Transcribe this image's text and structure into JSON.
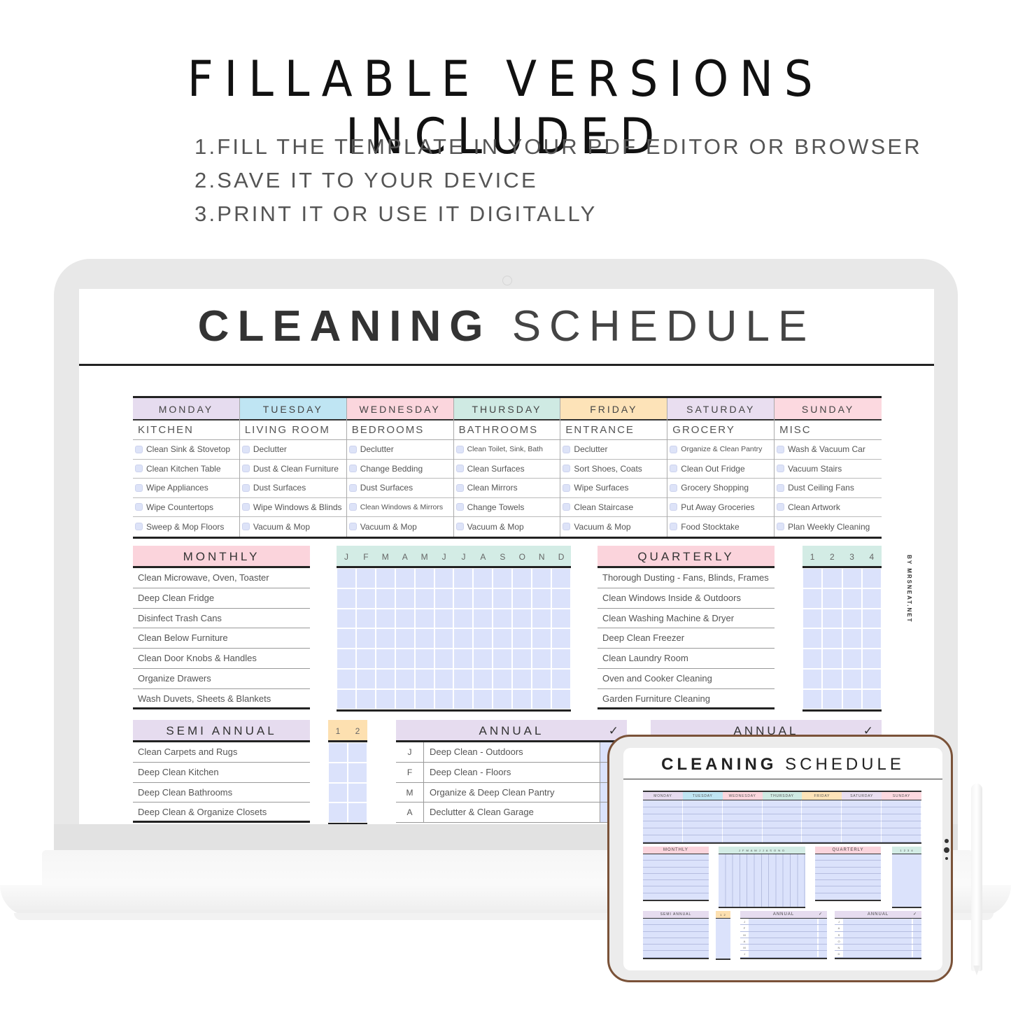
{
  "headline": "FILLABLE VERSIONS INCLUDED",
  "steps": [
    "1.FILL THE TEMPLATE IN YOUR PDF EDITOR OR BROWSER",
    "2.SAVE IT TO YOUR DEVICE",
    "3.PRINT IT OR USE IT DIGITALLY"
  ],
  "planner": {
    "title_bold": "CLEANING",
    "title_light": "SCHEDULE",
    "credit": "BY MRSNEAT.NET",
    "days": [
      {
        "day": "MONDAY",
        "color": "#e6dcef",
        "room": "KITCHEN",
        "tasks": [
          "Clean Sink & Stovetop",
          "Clean Kitchen Table",
          "Wipe Appliances",
          "Wipe Countertops",
          "Sweep & Mop Floors"
        ]
      },
      {
        "day": "TUESDAY",
        "color": "#bfe5f3",
        "room": "LIVING ROOM",
        "tasks": [
          "Declutter",
          "Dust & Clean Furniture",
          "Dust Surfaces",
          "Wipe Windows & Blinds",
          "Vacuum & Mop"
        ]
      },
      {
        "day": "WEDNESDAY",
        "color": "#fbd6dd",
        "room": "BEDROOMS",
        "tasks": [
          "Declutter",
          "Change Bedding",
          "Dust Surfaces",
          "Clean Windows & Mirrors",
          "Vacuum & Mop"
        ]
      },
      {
        "day": "THURSDAY",
        "color": "#cfeae3",
        "room": "BATHROOMS",
        "tasks": [
          "Clean Toilet, Sink, Bath",
          "Clean Surfaces",
          "Clean Mirrors",
          "Change Towels",
          "Vacuum & Mop"
        ]
      },
      {
        "day": "FRIDAY",
        "color": "#fde3b8",
        "room": "ENTRANCE",
        "tasks": [
          "Declutter",
          "Sort Shoes, Coats",
          "Wipe Surfaces",
          "Clean Staircase",
          "Vacuum & Mop"
        ]
      },
      {
        "day": "SATURDAY",
        "color": "#e9def0",
        "room": "GROCERY",
        "tasks": [
          "Organize & Clean Pantry",
          "Clean Out Fridge",
          "Grocery Shopping",
          "Put Away Groceries",
          "Food Stocktake"
        ]
      },
      {
        "day": "SUNDAY",
        "color": "#fcd9e0",
        "room": "MISC",
        "tasks": [
          "Wash & Vacuum Car",
          "Vacuum Stairs",
          "Dust Ceiling Fans",
          "Clean Artwork",
          "Plan Weekly Cleaning"
        ]
      }
    ],
    "monthly": {
      "title": "MONTHLY",
      "color": "#fbd4dc",
      "tasks": [
        "Clean Microwave, Oven, Toaster",
        "Deep Clean Fridge",
        "Disinfect Trash Cans",
        "Clean Below Furniture",
        "Clean Door Knobs & Handles",
        "Organize Drawers",
        "Wash Duvets, Sheets & Blankets"
      ],
      "months": [
        "J",
        "F",
        "M",
        "A",
        "M",
        "J",
        "J",
        "A",
        "S",
        "O",
        "N",
        "D"
      ],
      "months_color": "#d3ece5"
    },
    "quarterly": {
      "title": "QUARTERLY",
      "color": "#fbd4dc",
      "tasks": [
        "Thorough Dusting -  Fans, Blinds, Frames",
        "Clean Windows Inside & Outdoors",
        "Clean Washing Machine & Dryer",
        "Deep Clean Freezer",
        "Clean Laundry Room",
        "Oven and Cooker Cleaning",
        "Garden Furniture Cleaning"
      ],
      "quarters": [
        "1",
        "2",
        "3",
        "4"
      ],
      "quarters_color": "#d3ece5"
    },
    "semi_annual": {
      "title": "SEMI ANNUAL",
      "color": "#e6dcef",
      "tasks": [
        "Clean Carpets and Rugs",
        "Deep Clean Kitchen",
        "Deep Clean Bathrooms",
        "Deep Clean & Organize Closets"
      ],
      "halves": [
        "1",
        "2"
      ],
      "halves_color": "#fde0b0"
    },
    "annual": {
      "title": "ANNUAL",
      "color": "#e6dcef",
      "check": "✓",
      "rows": [
        {
          "letter": "J",
          "task": "Deep Clean - Outdoors"
        },
        {
          "letter": "F",
          "task": "Deep Clean - Floors"
        },
        {
          "letter": "M",
          "task": "Organize & Deep Clean Pantry"
        },
        {
          "letter": "A",
          "task": "Declutter & Clean Garage"
        }
      ]
    },
    "annual2": {
      "title": "ANNUAL",
      "check": "✓"
    }
  },
  "tablet": {
    "title_bold": "CLEANING",
    "title_light": "SCHEDULE",
    "days": [
      "MONDAY",
      "TUESDAY",
      "WEDNESDAY",
      "THURSDAY",
      "FRIDAY",
      "SATURDAY",
      "SUNDAY"
    ],
    "monthly": "MONTHLY",
    "months": "J F M A M J J A S O N D",
    "quarterly": "QUARTERLY",
    "quarters": "1 2 3 4",
    "semi_annual": "SEMI ANNUAL",
    "halves": "1 2",
    "annual": "ANNUAL",
    "check": "✓",
    "annual_letters_1": [
      "J",
      "F",
      "M",
      "A",
      "M",
      "J"
    ],
    "annual_letters_2": [
      "J",
      "A",
      "S",
      "O",
      "N",
      "D"
    ]
  }
}
